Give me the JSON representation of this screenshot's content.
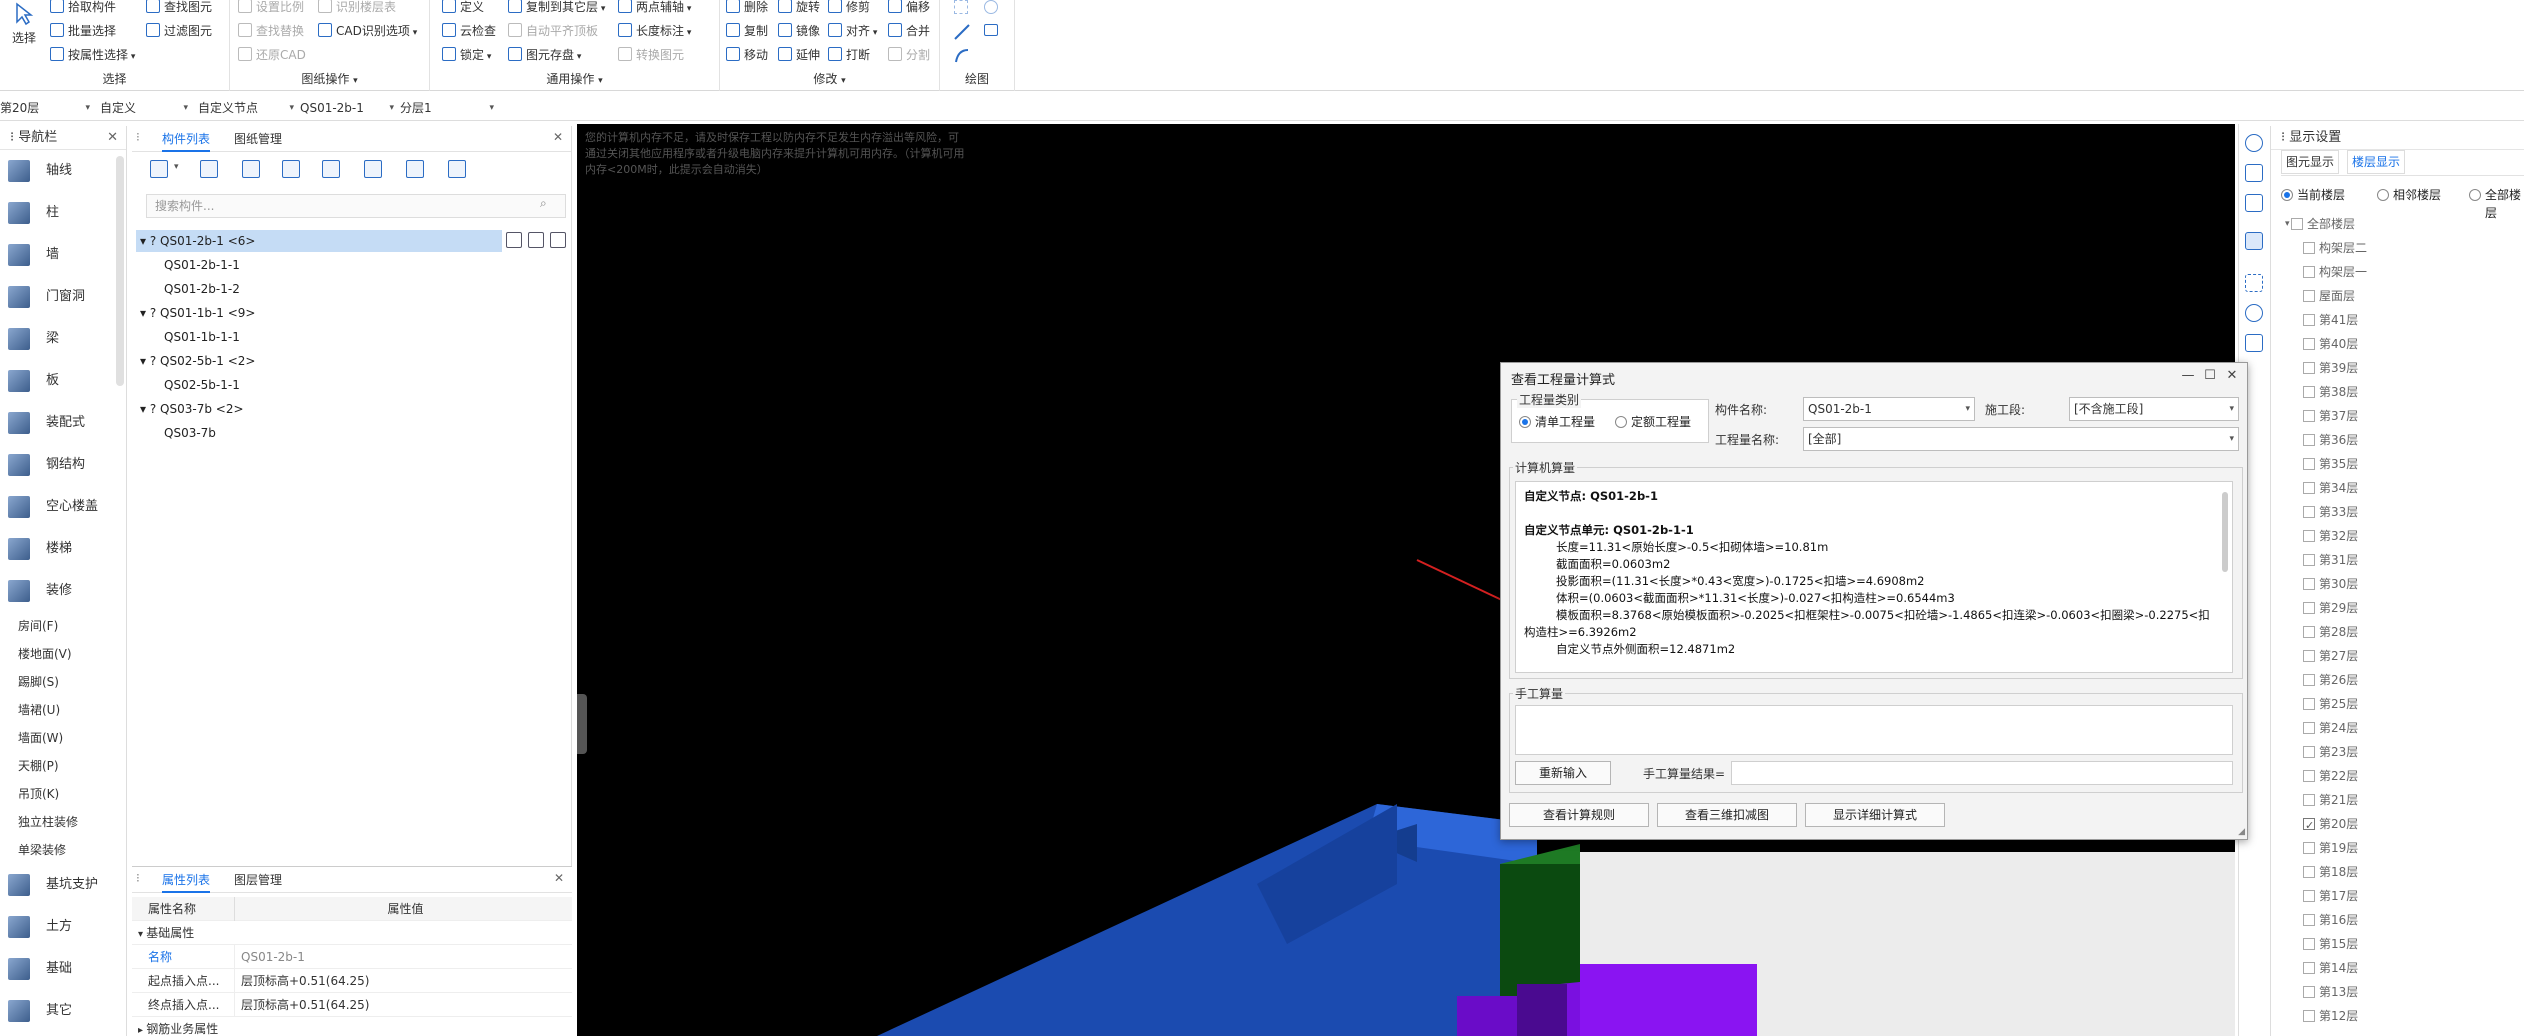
{
  "ribbon": {
    "select": {
      "title": "选择",
      "main": "选择",
      "items": [
        "拾取构件",
        "批量选择",
        "按属性选择"
      ]
    },
    "drawing_ops": {
      "title": "图纸操作",
      "items": [
        "设置比例",
        "查找替换",
        "还原CAD",
        "识别楼层表",
        "CAD识别选项",
        "查找图元",
        "过滤图元"
      ]
    },
    "common_ops": {
      "title": "通用操作",
      "items": [
        "定义",
        "云检查",
        "锁定",
        "复制到其它层",
        "自动平齐顶板",
        "图元存盘",
        "两点辅轴",
        "长度标注",
        "转换图元"
      ]
    },
    "modify": {
      "title": "修改",
      "items": [
        "删除",
        "复制",
        "移动",
        "旋转",
        "镜像",
        "延伸",
        "修剪",
        "对齐",
        "打断",
        "偏移",
        "合并",
        "分割"
      ]
    },
    "draw": {
      "title": "绘图"
    }
  },
  "filterbar": {
    "floor": "第20层",
    "category": "自定义",
    "type": "自定义节点",
    "component": "QS01-2b-1",
    "layer": "分层1"
  },
  "nav": {
    "title": "导航栏",
    "items": [
      "轴线",
      "柱",
      "墙",
      "门窗洞",
      "梁",
      "板",
      "装配式",
      "钢结构",
      "空心楼盖",
      "楼梯",
      "装修"
    ],
    "sub_items": [
      "房间(F)",
      "楼地面(V)",
      "踢脚(S)",
      "墙裙(U)",
      "墙面(W)",
      "天棚(P)",
      "吊顶(K)",
      "独立柱装修",
      "单梁装修"
    ],
    "items2": [
      "基坑支护",
      "土方",
      "基础",
      "其它"
    ]
  },
  "comp_list": {
    "tab_active": "构件列表",
    "tab_other": "图纸管理",
    "search_placeholder": "搜索构件...",
    "tree": [
      {
        "label": "QS01-2b-1 <6>",
        "level": 0,
        "selected": true
      },
      {
        "label": "QS01-2b-1-1",
        "level": 1
      },
      {
        "label": "QS01-2b-1-2",
        "level": 1
      },
      {
        "label": "QS01-1b-1 <9>",
        "level": 0
      },
      {
        "label": "QS01-1b-1-1",
        "level": 1
      },
      {
        "label": "QS02-5b-1 <2>",
        "level": 0
      },
      {
        "label": "QS02-5b-1-1",
        "level": 1
      },
      {
        "label": "QS03-7b <2>",
        "level": 0
      },
      {
        "label": "QS03-7b",
        "level": 1
      }
    ]
  },
  "props": {
    "tab_active": "属性列表",
    "tab_other": "图层管理",
    "col_name": "属性名称",
    "col_value": "属性值",
    "section": "基础属性",
    "rows": [
      {
        "name": "名称",
        "value": "QS01-2b-1"
      },
      {
        "name": "起点插入点...",
        "value": "层顶标高+0.51(64.25)"
      },
      {
        "name": "终点插入点...",
        "value": "层顶标高+0.51(64.25)"
      }
    ],
    "section2": "钢筋业务属性"
  },
  "viewport": {
    "notice": "您的计算机内存不足，请及时保存工程以防内存不足发生内存溢出等风险，可通过关闭其他应用程序或者升级电脑内存来提升计算机可用内存。（计算机可用内存<200M时，此提示会自动消失）"
  },
  "display": {
    "title": "显示设置",
    "tab_other": "图元显示",
    "tab_active": "楼层显示",
    "radio_current": "当前楼层",
    "radio_related": "相邻楼层",
    "radio_all": "全部楼层",
    "all_floors": "全部楼层",
    "floors": [
      "构架层二",
      "构架层一",
      "屋面层",
      "第41层",
      "第40层",
      "第39层",
      "第38层",
      "第37层",
      "第36层",
      "第35层",
      "第34层",
      "第33层",
      "第32层",
      "第31层",
      "第30层",
      "第29层",
      "第28层",
      "第27层",
      "第26层",
      "第25层",
      "第24层",
      "第23层",
      "第22层",
      "第21层",
      "第20层",
      "第19层",
      "第18层",
      "第17层",
      "第16层",
      "第15层",
      "第14层",
      "第13层",
      "第12层"
    ],
    "checked_floor": "第20层"
  },
  "dialog": {
    "title": "查看工程量计算式",
    "type_group": "工程量类别",
    "radio_list": "清单工程量",
    "radio_quota": "定额工程量",
    "comp_name_label": "构件名称:",
    "comp_name_value": "QS01-2b-1",
    "stage_label": "施工段:",
    "stage_value": "[不含施工段]",
    "qty_name_label": "工程量名称:",
    "qty_name_value": "[全部]",
    "computer_calc": "计算机算量",
    "calc_lines": [
      "自定义节点: QS01-2b-1",
      "",
      "自定义节点单元: QS01-2b-1-1",
      "长度=11.31<原始长度>-0.5<扣砌体墙>=10.81m",
      "截面面积=0.0603m2",
      "投影面积=(11.31<长度>*0.43<宽度>)-0.1725<扣墙>=4.6908m2",
      "体积=(0.0603<截面面积>*11.31<长度>)-0.027<扣构造柱>=0.6544m3",
      "模板面积=8.3768<原始模板面积>-0.2025<扣框架柱>-0.0075<扣砼墙>-1.4865<扣连梁>-0.0603<扣圈梁>-0.2275<扣",
      "构造柱>=6.3926m2",
      "自定义节点外侧面积=12.4871m2"
    ],
    "manual_calc": "手工算量",
    "reinput": "重新输入",
    "manual_result_label": "手工算量结果=",
    "btn_rules": "查看计算规则",
    "btn_3d": "查看三维扣减图",
    "btn_detail": "显示详细计算式"
  }
}
